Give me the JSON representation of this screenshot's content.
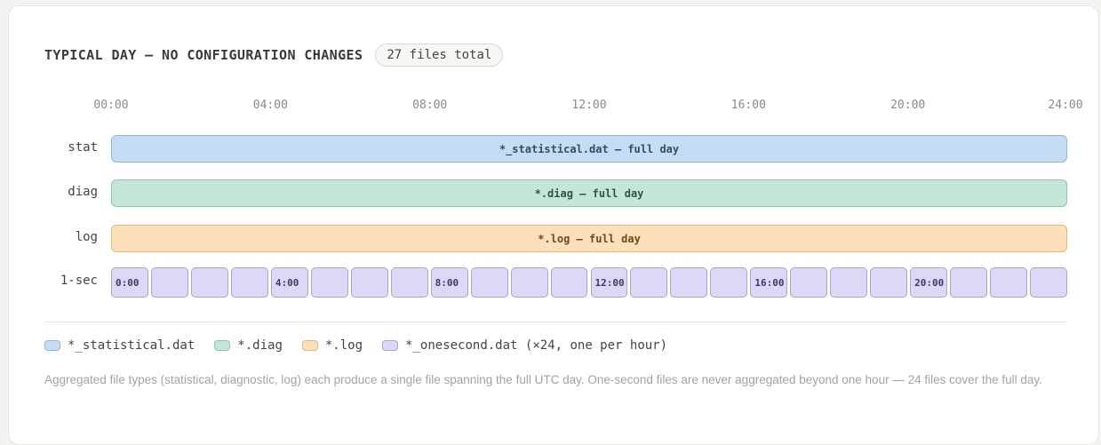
{
  "header": {
    "title": "TYPICAL DAY — NO CONFIGURATION CHANGES",
    "badge": "27 files total"
  },
  "axis": {
    "ticks": [
      "00:00",
      "04:00",
      "08:00",
      "12:00",
      "16:00",
      "20:00",
      "24:00"
    ]
  },
  "rows": {
    "stat": {
      "label": "stat",
      "bar_text": "*_statistical.dat — full day"
    },
    "diag": {
      "label": "diag",
      "bar_text": "*.diag — full day"
    },
    "log": {
      "label": "log",
      "bar_text": "*.log — full day"
    },
    "onesec": {
      "label": "1-sec",
      "segment_count": 24,
      "segment_labels": {
        "0": "0:00",
        "4": "4:00",
        "8": "8:00",
        "12": "12:00",
        "16": "16:00",
        "20": "20:00"
      }
    }
  },
  "legend": [
    {
      "name": "*_statistical.dat",
      "color": "#c6dcf2"
    },
    {
      "name": "*.diag",
      "color": "#c3e6d6"
    },
    {
      "name": "*.log",
      "color": "#fbe0b9"
    },
    {
      "name": "*_onesecond.dat (×24, one per hour)",
      "color": "#dcd8f6"
    }
  ],
  "note": "Aggregated file types (statistical, diagnostic, log) each produce a single file spanning the full UTC day. One-second files are never aggregated beyond one hour — 24 files cover the full day."
}
